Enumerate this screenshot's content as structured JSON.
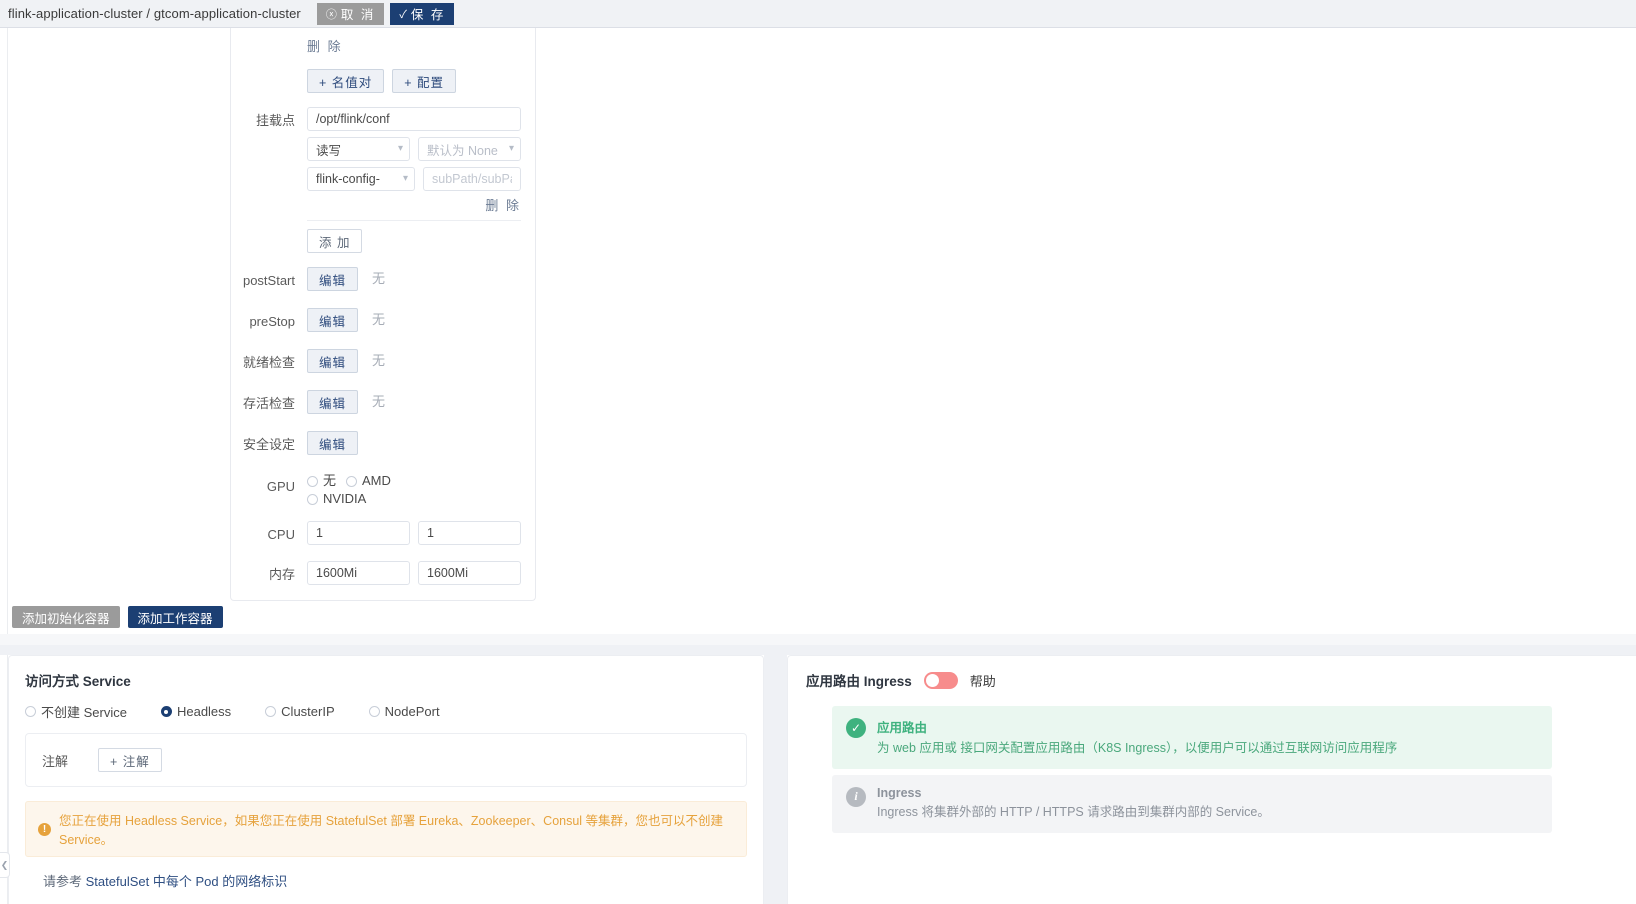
{
  "topbar": {
    "breadcrumb": "flink-application-cluster / gtcom-application-cluster",
    "cancel_label": "取 消",
    "save_label": "保 存",
    "cancel_icon": "circle-x-icon",
    "save_icon": "circle-check-icon"
  },
  "container_form": {
    "delete_top_label": "删 除",
    "add_keyvalue_label": "+ 名值对",
    "add_config_label": "+ 配置",
    "mount_label": "挂载点",
    "mount_path_value": "/opt/flink/conf",
    "mount_mode_value": "读写",
    "mount_none_placeholder": "默认为 None",
    "mount_source_value": "flink-config-",
    "subpath_placeholder": "subPath/subPathE",
    "delete_mount_label": "删 除",
    "add_label": "添 加",
    "poststart_label": "postStart",
    "poststart_btn": "编辑",
    "poststart_value": "无",
    "prestop_label": "preStop",
    "prestop_btn": "编辑",
    "prestop_value": "无",
    "readiness_label": "就绪检查",
    "readiness_btn": "编辑",
    "readiness_value": "无",
    "liveness_label": "存活检查",
    "liveness_btn": "编辑",
    "liveness_value": "无",
    "security_label": "安全设定",
    "security_btn": "编辑",
    "gpu_label": "GPU",
    "gpu_options": [
      "无",
      "AMD",
      "NVIDIA"
    ],
    "cpu_label": "CPU",
    "cpu_request": "1",
    "cpu_limit": "1",
    "memory_label": "内存",
    "memory_request": "1600Mi",
    "memory_limit": "1600Mi"
  },
  "actions": {
    "add_init_container": "添加初始化容器",
    "add_work_container": "添加工作容器"
  },
  "service": {
    "title": "访问方式 Service",
    "options": [
      {
        "label": "不创建 Service",
        "selected": false
      },
      {
        "label": "Headless",
        "selected": true
      },
      {
        "label": "ClusterIP",
        "selected": false
      },
      {
        "label": "NodePort",
        "selected": false
      }
    ],
    "annotation_label": "注解",
    "annotation_button": "+ 注解",
    "warning_icon": "warning-icon",
    "warning_text": "您正在使用 Headless Service，如果您正在使用 StatefulSet 部署 Eureka、Zookeeper、Consul 等集群，您也可以不创建 Service。",
    "reference_prefix": "请参考 ",
    "reference_link": "StatefulSet 中每个 Pod 的网络标识"
  },
  "ingress": {
    "title": "应用路由 Ingress",
    "toggle_state": "off",
    "help_label": "帮助",
    "cards": [
      {
        "icon": "check-circle-icon",
        "title": "应用路由",
        "desc": "为 web 应用或 接口网关配置应用路由（K8S Ingress），以便用户可以通过互联网访问应用程序"
      },
      {
        "icon": "info-circle-icon",
        "title": "Ingress",
        "desc": "Ingress 将集群外部的 HTTP / HTTPS 请求路由到集群内部的 Service。"
      }
    ]
  },
  "colors": {
    "navy": "#1c3f73",
    "gray_button": "#9b9b9b",
    "warning": "#e6a23c",
    "success": "#3fb27f",
    "toggle_off": "#f78c8c"
  },
  "sidebar": {
    "collapse_icon": "chevron-left-icon"
  }
}
